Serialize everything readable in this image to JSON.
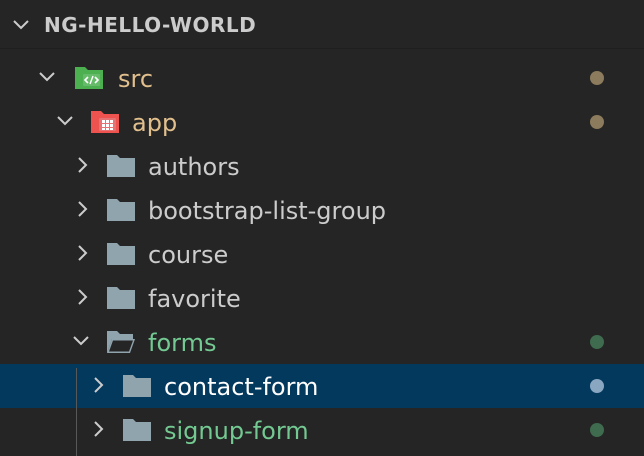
{
  "explorer": {
    "section_title": "NG-HELLO-WORLD"
  },
  "tree": {
    "src": {
      "label": "src"
    },
    "app": {
      "label": "app"
    },
    "authors": {
      "label": "authors"
    },
    "bootstrap_list_group": {
      "label": "bootstrap-list-group"
    },
    "course": {
      "label": "course"
    },
    "favorite": {
      "label": "favorite"
    },
    "forms": {
      "label": "forms"
    },
    "contact_form": {
      "label": "contact-form"
    },
    "signup_form": {
      "label": "signup-form"
    }
  },
  "colors": {
    "background": "#252526",
    "selection": "#04395e",
    "modified_text": "#e2c08d",
    "added_text": "#73c991",
    "modified_dot": "#8c7b5c",
    "added_dot": "#3f6b4e",
    "selected_dot": "#8aa7c2",
    "folder_icon": "#90a4ae",
    "src_icon": "#4caf50",
    "app_icon": "#ef5350"
  }
}
